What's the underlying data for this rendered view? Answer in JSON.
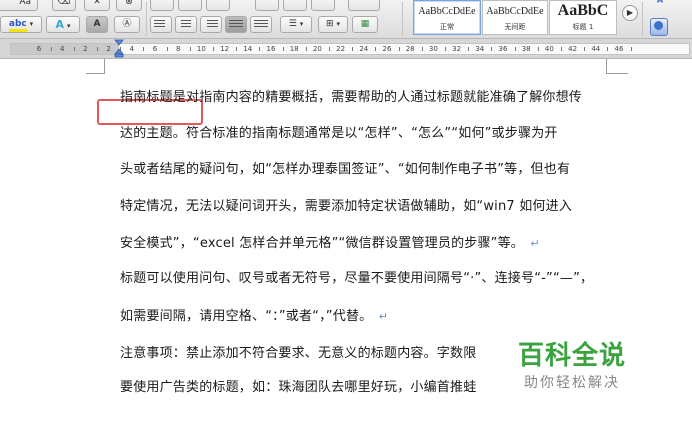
{
  "ribbon": {
    "font_size_value": "Aa",
    "styles": [
      {
        "sample": "AaBbCcDdEe",
        "name": "正常",
        "active": true
      },
      {
        "sample": "AaBbCcDdEe",
        "name": "无间距",
        "active": false
      },
      {
        "sample": "AaBbC",
        "name": "标题 1",
        "active": false
      }
    ],
    "text_effects_letter": "A"
  },
  "ruler": {
    "numbers": [
      "6",
      "4",
      "2",
      "2",
      "4",
      "6",
      "8",
      "10",
      "12",
      "14",
      "16",
      "18",
      "20",
      "22",
      "24",
      "26",
      "28",
      "30",
      "32",
      "34",
      "36",
      "38",
      "40",
      "42",
      "44",
      "46"
    ]
  },
  "document": {
    "paragraphs": [
      {
        "text": "指南标题是对指南内容的精要概括，需要帮助的人通过标题就能准确了解你想传",
        "return_mark": false
      },
      {
        "text": "达的主题。符合标准的指南标题通常是以“怎样”、“怎么”“如何”或步骤为开",
        "return_mark": false
      },
      {
        "text": "头或者结尾的疑问句，如“怎样办理泰国签证”、“如何制作电子书”等，但也有",
        "return_mark": false
      },
      {
        "text": "特定情况，无法以疑问词开头，需要添加特定状语做辅助，如“win7 如何进入",
        "return_mark": false
      },
      {
        "text": "安全模式”，“excel 怎样合并单元格”“微信群设置管理员的步骤”等。",
        "return_mark": true
      },
      {
        "text": "标题可以使用问句、叹号或者无符号，尽量不要使用间隔号“·”、连接号“-”“—”，",
        "return_mark": false
      },
      {
        "text": "如需要间隔，请用空格、“：”或者“，”代替。",
        "return_mark": true
      },
      {
        "text": "注意事项：禁止添加不符合要求、无意义的标题内容。字数限",
        "return_mark": false
      },
      {
        "text": "要使用广告类的标题，如：珠海团队去哪里好玩，小编首推蛙",
        "return_mark": false
      }
    ],
    "return_symbol": "↵"
  },
  "watermark": {
    "title": "百科全说",
    "subtitle": "助你轻松解决"
  },
  "colors": {
    "highlight": "#e45a5a",
    "watermark_green": "#3aa33f",
    "return_mark": "#6c8fd0"
  }
}
